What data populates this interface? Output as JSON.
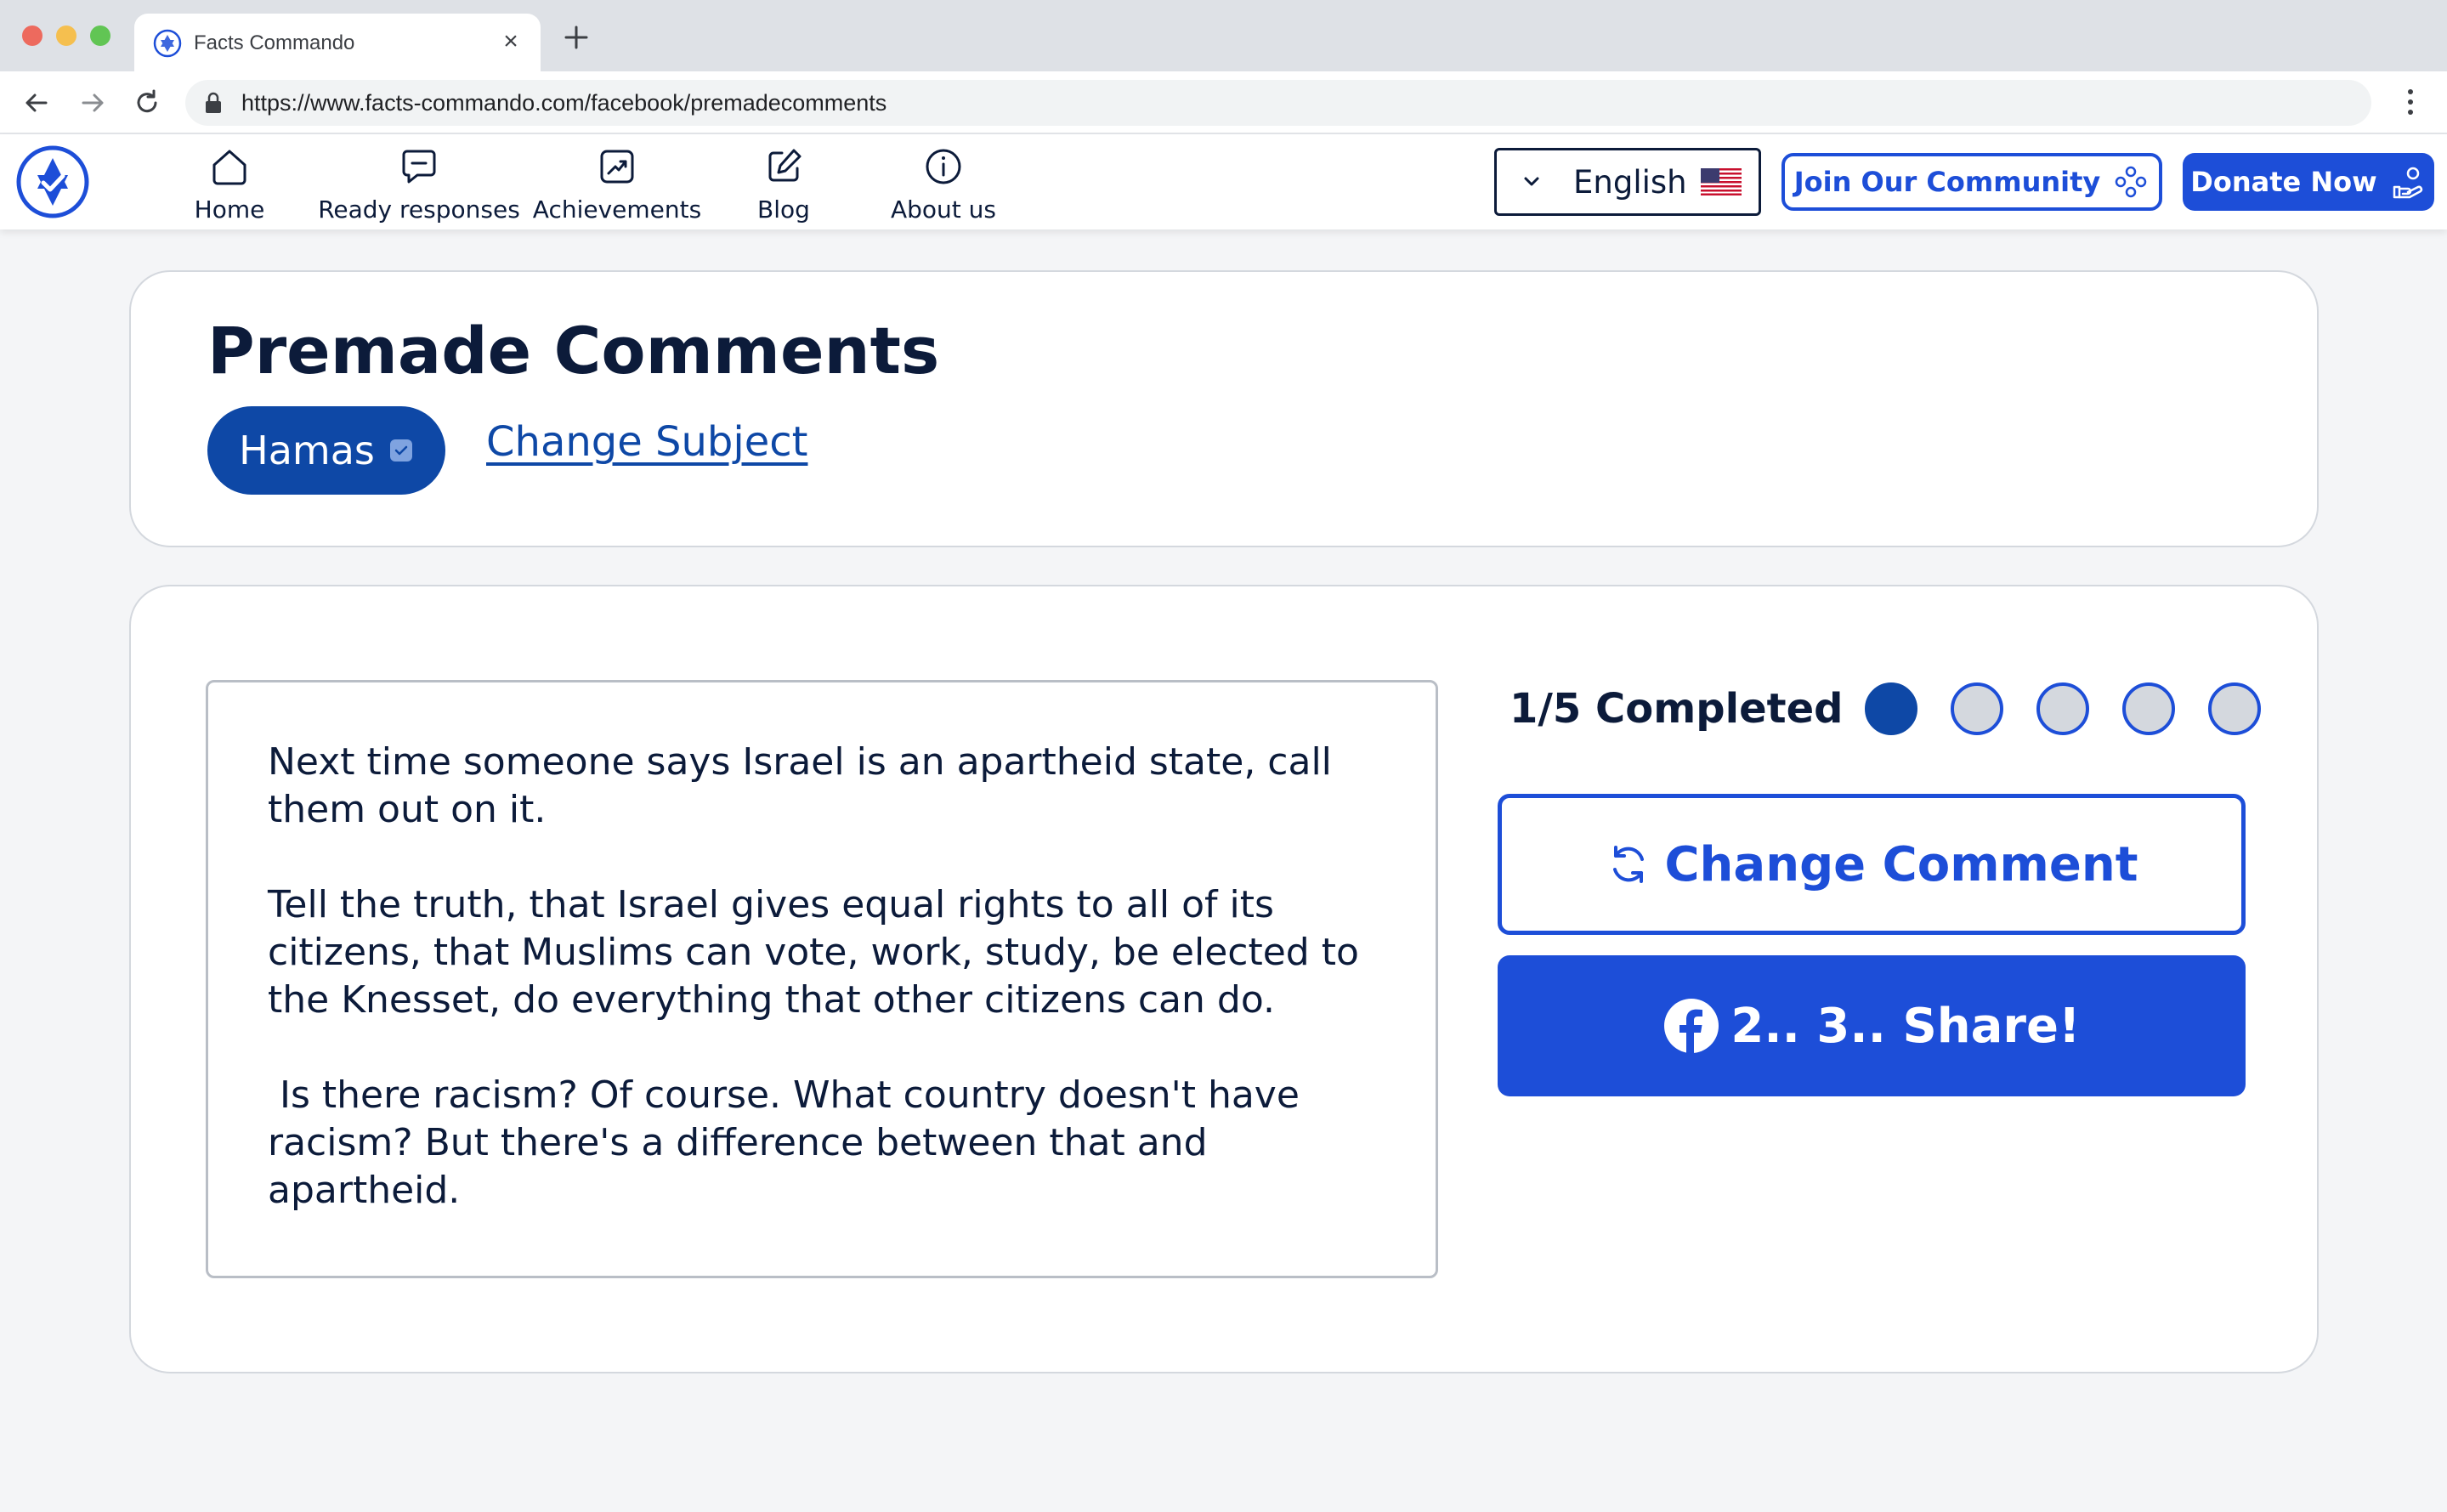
{
  "browser": {
    "tab_title": "Facts Commando",
    "tab_close": "×",
    "url": "https://www.facts-commando.com/facebook/premadecomments"
  },
  "nav": {
    "items": [
      {
        "label": "Home",
        "icon": "home-icon"
      },
      {
        "label": "Ready responses",
        "icon": "chat-icon"
      },
      {
        "label": "Achievements",
        "icon": "trend-icon"
      },
      {
        "label": "Blog",
        "icon": "edit-icon"
      },
      {
        "label": "About us",
        "icon": "info-icon"
      }
    ],
    "language": "English",
    "join_label": "Join Our Community",
    "donate_label": "Donate Now"
  },
  "page": {
    "title": "Premade Comments",
    "subject": "Hamas",
    "change_subject": "Change Subject"
  },
  "comment": {
    "paragraphs": [
      "Next time someone says Israel is an apartheid state, call them out on it.",
      "Tell the truth, that Israel gives equal rights to all of its citizens, that Muslims can vote, work, study, be elected to the Knesset, do everything that other citizens can do.",
      " Is there racism? Of course. What country doesn't have racism? But there's a difference between that and apartheid."
    ]
  },
  "progress": {
    "label": "1/5 Completed",
    "completed": 1,
    "total": 5
  },
  "actions": {
    "change_comment": "Change Comment",
    "share": "2.. 3.. Share!"
  },
  "colors": {
    "brand_blue": "#1d4ed8",
    "navy": "#0e48a6",
    "text_dark": "#0c1b3a"
  }
}
